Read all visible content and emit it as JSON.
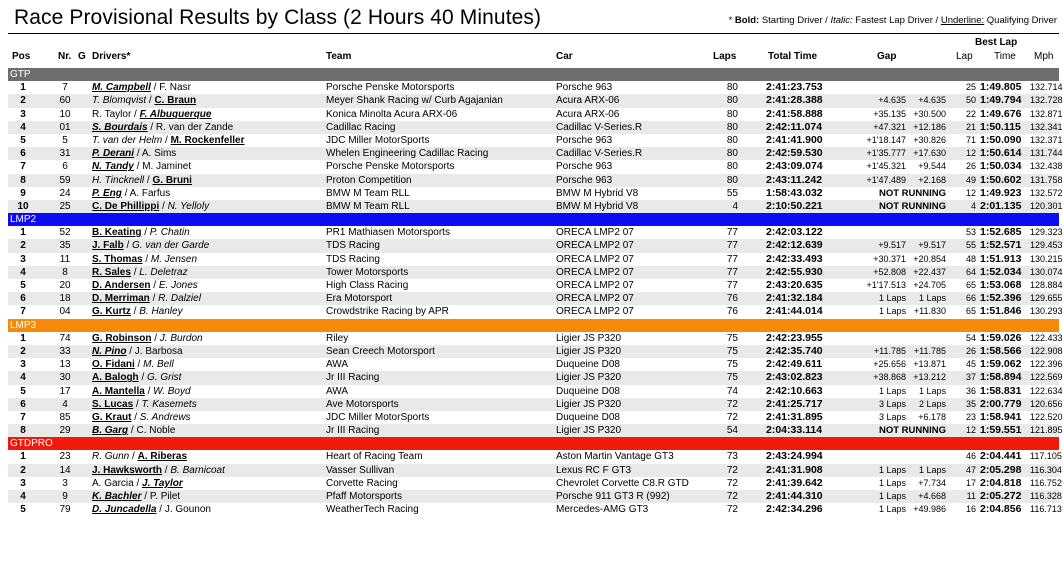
{
  "header": {
    "title": "Race Provisional Results by Class (2 Hours 40 Minutes)",
    "legend": {
      "prefix": "* ",
      "bold": "Bold:",
      "bold_text": " Starting Driver / ",
      "italic": "Italic:",
      "italic_text": " Fastest Lap Driver / ",
      "underline": "Underline:",
      "underline_text": " Qualifying Driver"
    }
  },
  "columns": {
    "pos": "Pos",
    "nr": "Nr.",
    "g": "G",
    "drivers": "Drivers*",
    "team": "Team",
    "car": "Car",
    "laps": "Laps",
    "total_time": "Total Time",
    "gap": "Gap",
    "best_lap": "Best Lap",
    "lap": "Lap",
    "time": "Time",
    "mph": "Mph"
  },
  "colors": {
    "GTP": "#6e6e6e",
    "LMP2": "#0c0cf2",
    "LMP3": "#f58a0a",
    "GTDPRO": "#f2190c"
  },
  "classes": [
    {
      "name": "GTP",
      "rows": [
        {
          "pos": "1",
          "nr": "7",
          "d1": {
            "name": "M. Campbell",
            "s": "biu"
          },
          "d2": {
            "name": "F. Nasr",
            "s": ""
          },
          "team": "Porsche Penske Motorsports",
          "car": "Porsche 963",
          "laps": "80",
          "total": "2:41:23.753",
          "gap1": "",
          "gap2": "",
          "bl": "25",
          "bt": "1:49.805",
          "mph": "132.714"
        },
        {
          "pos": "2",
          "nr": "60",
          "d1": {
            "name": "T. Blomqvist",
            "s": "i"
          },
          "d2": {
            "name": "C. Braun",
            "s": "bu"
          },
          "team": "Meyer Shank Racing w/ Curb Agajanian",
          "car": "Acura ARX-06",
          "laps": "80",
          "total": "2:41:28.388",
          "gap1": "+4.635",
          "gap2": "+4.635",
          "bl": "50",
          "bt": "1:49.794",
          "mph": "132.728"
        },
        {
          "pos": "3",
          "nr": "10",
          "d1": {
            "name": "R. Taylor",
            "s": ""
          },
          "d2": {
            "name": "F. Albuquerque",
            "s": "biu"
          },
          "team": "Konica Minolta Acura ARX-06",
          "car": "Acura ARX-06",
          "laps": "80",
          "total": "2:41:58.888",
          "gap1": "+35.135",
          "gap2": "+30.500",
          "bl": "22",
          "bt": "1:49.676",
          "mph": "132.871"
        },
        {
          "pos": "4",
          "nr": "01",
          "d1": {
            "name": "S. Bourdais",
            "s": "biu"
          },
          "d2": {
            "name": "R. van der Zande",
            "s": ""
          },
          "team": "Cadillac Racing",
          "car": "Cadillac V-Series.R",
          "laps": "80",
          "total": "2:42:11.074",
          "gap1": "+47.321",
          "gap2": "+12.186",
          "bl": "21",
          "bt": "1:50.115",
          "mph": "132.341"
        },
        {
          "pos": "5",
          "nr": "5",
          "d1": {
            "name": "T. van der Helm",
            "s": "i"
          },
          "d2": {
            "name": "M. Rockenfeller",
            "s": "bu"
          },
          "team": "JDC Miller MotorSports",
          "car": "Porsche 963",
          "laps": "80",
          "total": "2:41:41.900",
          "gap1": "+1'18.147",
          "gap2": "+30.826",
          "bl": "71",
          "bt": "1:50.090",
          "mph": "132.371"
        },
        {
          "pos": "6",
          "nr": "31",
          "d1": {
            "name": "P. Derani",
            "s": "biu"
          },
          "d2": {
            "name": "A. Sims",
            "s": ""
          },
          "team": "Whelen Engineering Cadillac Racing",
          "car": "Cadillac V-Series.R",
          "laps": "80",
          "total": "2:42:59.530",
          "gap1": "+1'35.777",
          "gap2": "+17.630",
          "bl": "12",
          "bt": "1:50.614",
          "mph": "131.744"
        },
        {
          "pos": "7",
          "nr": "6",
          "d1": {
            "name": "N. Tandy",
            "s": "biu"
          },
          "d2": {
            "name": "M. Jaminet",
            "s": ""
          },
          "team": "Porsche Penske Motorsports",
          "car": "Porsche 963",
          "laps": "80",
          "total": "2:43:09.074",
          "gap1": "+1'45.321",
          "gap2": "+9.544",
          "bl": "26",
          "bt": "1:50.034",
          "mph": "132.438"
        },
        {
          "pos": "8",
          "nr": "59",
          "d1": {
            "name": "H. Tincknell",
            "s": "i"
          },
          "d2": {
            "name": "G. Bruni",
            "s": "bu"
          },
          "team": "Proton Competition",
          "car": "Porsche 963",
          "laps": "80",
          "total": "2:43:11.242",
          "gap1": "+1'47.489",
          "gap2": "+2.168",
          "bl": "49",
          "bt": "1:50.602",
          "mph": "131.758"
        },
        {
          "pos": "9",
          "nr": "24",
          "d1": {
            "name": "P. Eng",
            "s": "biu"
          },
          "d2": {
            "name": "A. Farfus",
            "s": ""
          },
          "team": "BMW M Team RLL",
          "car": "BMW M Hybrid V8",
          "laps": "55",
          "total": "1:58:43.032",
          "status": "NOT RUNNING",
          "bl": "12",
          "bt": "1:49.923",
          "mph": "132.572"
        },
        {
          "pos": "10",
          "nr": "25",
          "d1": {
            "name": "C. De Phillippi",
            "s": "bu"
          },
          "d2": {
            "name": "N. Yelloly",
            "s": "i"
          },
          "team": "BMW M Team RLL",
          "car": "BMW M Hybrid V8",
          "laps": "4",
          "total": "2:10:50.221",
          "status": "NOT RUNNING",
          "bl": "4",
          "bt": "2:01.135",
          "mph": "120.301"
        }
      ]
    },
    {
      "name": "LMP2",
      "rows": [
        {
          "pos": "1",
          "nr": "52",
          "d1": {
            "name": "B. Keating",
            "s": "bu"
          },
          "d2": {
            "name": "P. Chatin",
            "s": "i"
          },
          "team": "PR1 Mathiasen Motorsports",
          "car": "ORECA LMP2 07",
          "laps": "77",
          "total": "2:42:03.122",
          "gap1": "",
          "gap2": "",
          "bl": "53",
          "bt": "1:52.685",
          "mph": "129.323"
        },
        {
          "pos": "2",
          "nr": "35",
          "d1": {
            "name": "J. Falb",
            "s": "bu"
          },
          "d2": {
            "name": "G. van der Garde",
            "s": "i"
          },
          "team": "TDS Racing",
          "car": "ORECA LMP2 07",
          "laps": "77",
          "total": "2:42:12.639",
          "gap1": "+9.517",
          "gap2": "+9.517",
          "bl": "55",
          "bt": "1:52.571",
          "mph": "129.453"
        },
        {
          "pos": "3",
          "nr": "11",
          "d1": {
            "name": "S. Thomas",
            "s": "bu"
          },
          "d2": {
            "name": "M. Jensen",
            "s": "i"
          },
          "team": "TDS Racing",
          "car": "ORECA LMP2 07",
          "laps": "77",
          "total": "2:42:33.493",
          "gap1": "+30.371",
          "gap2": "+20.854",
          "bl": "48",
          "bt": "1:51.913",
          "mph": "130.215"
        },
        {
          "pos": "4",
          "nr": "8",
          "d1": {
            "name": "R. Sales",
            "s": "bu"
          },
          "d2": {
            "name": "L. Deletraz",
            "s": "i"
          },
          "team": "Tower Motorsports",
          "car": "ORECA LMP2 07",
          "laps": "77",
          "total": "2:42:55.930",
          "gap1": "+52.808",
          "gap2": "+22.437",
          "bl": "64",
          "bt": "1:52.034",
          "mph": "130.074"
        },
        {
          "pos": "5",
          "nr": "20",
          "d1": {
            "name": "D. Andersen",
            "s": "bu"
          },
          "d2": {
            "name": "E. Jones",
            "s": "i"
          },
          "team": "High Class Racing",
          "car": "ORECA LMP2 07",
          "laps": "77",
          "total": "2:43:20.635",
          "gap1": "+1'17.513",
          "gap2": "+24.705",
          "bl": "65",
          "bt": "1:53.068",
          "mph": "128.884"
        },
        {
          "pos": "6",
          "nr": "18",
          "d1": {
            "name": "D. Merriman",
            "s": "bu"
          },
          "d2": {
            "name": "R. Dalziel",
            "s": "i"
          },
          "team": "Era Motorsport",
          "car": "ORECA LMP2 07",
          "laps": "76",
          "total": "2:41:32.184",
          "gap1": "1 Laps",
          "gap2": "1 Laps",
          "bl": "66",
          "bt": "1:52.396",
          "mph": "129.655"
        },
        {
          "pos": "7",
          "nr": "04",
          "d1": {
            "name": "G. Kurtz",
            "s": "bu"
          },
          "d2": {
            "name": "B. Hanley",
            "s": "i"
          },
          "team": "Crowdstrike Racing by APR",
          "car": "ORECA LMP2 07",
          "laps": "76",
          "total": "2:41:44.014",
          "gap1": "1 Laps",
          "gap2": "+11.830",
          "bl": "65",
          "bt": "1:51.846",
          "mph": "130.293"
        }
      ]
    },
    {
      "name": "LMP3",
      "rows": [
        {
          "pos": "1",
          "nr": "74",
          "d1": {
            "name": "G. Robinson",
            "s": "bu"
          },
          "d2": {
            "name": "J. Burdon",
            "s": "i"
          },
          "team": "Riley",
          "car": "Ligier JS P320",
          "laps": "75",
          "total": "2:42:23.955",
          "gap1": "",
          "gap2": "",
          "bl": "54",
          "bt": "1:59.026",
          "mph": "122.433"
        },
        {
          "pos": "2",
          "nr": "33",
          "d1": {
            "name": "N. Pino",
            "s": "biu"
          },
          "d2": {
            "name": "J. Barbosa",
            "s": ""
          },
          "team": "Sean Creech Motorsport",
          "car": "Ligier JS P320",
          "laps": "75",
          "total": "2:42:35.740",
          "gap1": "+11.785",
          "gap2": "+11.785",
          "bl": "26",
          "bt": "1:58.566",
          "mph": "122.908"
        },
        {
          "pos": "3",
          "nr": "13",
          "d1": {
            "name": "O. Fidani",
            "s": "bu"
          },
          "d2": {
            "name": "M. Bell",
            "s": "i"
          },
          "team": "AWA",
          "car": "Duqueine D08",
          "laps": "75",
          "total": "2:42:49.611",
          "gap1": "+25.656",
          "gap2": "+13.871",
          "bl": "45",
          "bt": "1:59.062",
          "mph": "122.396"
        },
        {
          "pos": "4",
          "nr": "30",
          "d1": {
            "name": "A. Balogh",
            "s": "bu"
          },
          "d2": {
            "name": "G. Grist",
            "s": "i"
          },
          "team": "Jr III Racing",
          "car": "Ligier JS P320",
          "laps": "75",
          "total": "2:43:02.823",
          "gap1": "+38.868",
          "gap2": "+13.212",
          "bl": "37",
          "bt": "1:58.894",
          "mph": "122.569"
        },
        {
          "pos": "5",
          "nr": "17",
          "d1": {
            "name": "A. Mantella",
            "s": "bu"
          },
          "d2": {
            "name": "W. Boyd",
            "s": "i"
          },
          "team": "AWA",
          "car": "Duqueine D08",
          "laps": "74",
          "total": "2:42:10.663",
          "gap1": "1 Laps",
          "gap2": "1 Laps",
          "bl": "36",
          "bt": "1:58.831",
          "mph": "122.634"
        },
        {
          "pos": "6",
          "nr": "4",
          "d1": {
            "name": "S. Lucas",
            "s": "bu"
          },
          "d2": {
            "name": "T. Kasemets",
            "s": "i"
          },
          "team": "Ave Motorsports",
          "car": "Ligier JS P320",
          "laps": "72",
          "total": "2:41:25.717",
          "gap1": "3 Laps",
          "gap2": "2 Laps",
          "bl": "35",
          "bt": "2:00.779",
          "mph": "120.656"
        },
        {
          "pos": "7",
          "nr": "85",
          "d1": {
            "name": "G. Kraut",
            "s": "bu"
          },
          "d2": {
            "name": "S. Andrews",
            "s": "i"
          },
          "team": "JDC Miller MotorSports",
          "car": "Duqueine D08",
          "laps": "72",
          "total": "2:41:31.895",
          "gap1": "3 Laps",
          "gap2": "+6.178",
          "bl": "23",
          "bt": "1:58.941",
          "mph": "122.520"
        },
        {
          "pos": "8",
          "nr": "29",
          "d1": {
            "name": "B. Garg",
            "s": "biu"
          },
          "d2": {
            "name": "C. Noble",
            "s": ""
          },
          "team": "Jr III Racing",
          "car": "Ligier JS P320",
          "laps": "54",
          "total": "2:04:33.114",
          "status": "NOT RUNNING",
          "bl": "12",
          "bt": "1:59.551",
          "mph": "121.895"
        }
      ]
    },
    {
      "name": "GTDPRO",
      "rows": [
        {
          "pos": "1",
          "nr": "23",
          "d1": {
            "name": "R. Gunn",
            "s": "i"
          },
          "d2": {
            "name": "A. Riberas",
            "s": "bu"
          },
          "team": "Heart of Racing Team",
          "car": "Aston Martin Vantage GT3",
          "laps": "73",
          "total": "2:43:24.994",
          "gap1": "",
          "gap2": "",
          "bl": "46",
          "bt": "2:04.441",
          "mph": "117.105"
        },
        {
          "pos": "2",
          "nr": "14",
          "d1": {
            "name": "J. Hawksworth",
            "s": "bu"
          },
          "d2": {
            "name": "B. Barnicoat",
            "s": "i"
          },
          "team": "Vasser Sullivan",
          "car": "Lexus RC F GT3",
          "laps": "72",
          "total": "2:41:31.908",
          "gap1": "1 Laps",
          "gap2": "1 Laps",
          "bl": "47",
          "bt": "2:05.298",
          "mph": "116.304"
        },
        {
          "pos": "3",
          "nr": "3",
          "d1": {
            "name": "A. Garcia",
            "s": ""
          },
          "d2": {
            "name": "J. Taylor",
            "s": "biu"
          },
          "team": "Corvette Racing",
          "car": "Chevrolet Corvette C8.R GTD",
          "laps": "72",
          "total": "2:41:39.642",
          "gap1": "1 Laps",
          "gap2": "+7.734",
          "bl": "17",
          "bt": "2:04.818",
          "mph": "116.752"
        },
        {
          "pos": "4",
          "nr": "9",
          "d1": {
            "name": "K. Bachler",
            "s": "biu"
          },
          "d2": {
            "name": "P. Pilet",
            "s": ""
          },
          "team": "Pfaff Motorsports",
          "car": "Porsche 911 GT3 R (992)",
          "laps": "72",
          "total": "2:41:44.310",
          "gap1": "1 Laps",
          "gap2": "+4.668",
          "bl": "11",
          "bt": "2:05.272",
          "mph": "116.328"
        },
        {
          "pos": "5",
          "nr": "79",
          "d1": {
            "name": "D. Juncadella",
            "s": "biu"
          },
          "d2": {
            "name": "J. Gounon",
            "s": ""
          },
          "team": "WeatherTech Racing",
          "car": "Mercedes-AMG GT3",
          "laps": "72",
          "total": "2:42:34.296",
          "gap1": "1 Laps",
          "gap2": "+49.986",
          "bl": "16",
          "bt": "2:04.856",
          "mph": "116.713"
        }
      ]
    }
  ]
}
